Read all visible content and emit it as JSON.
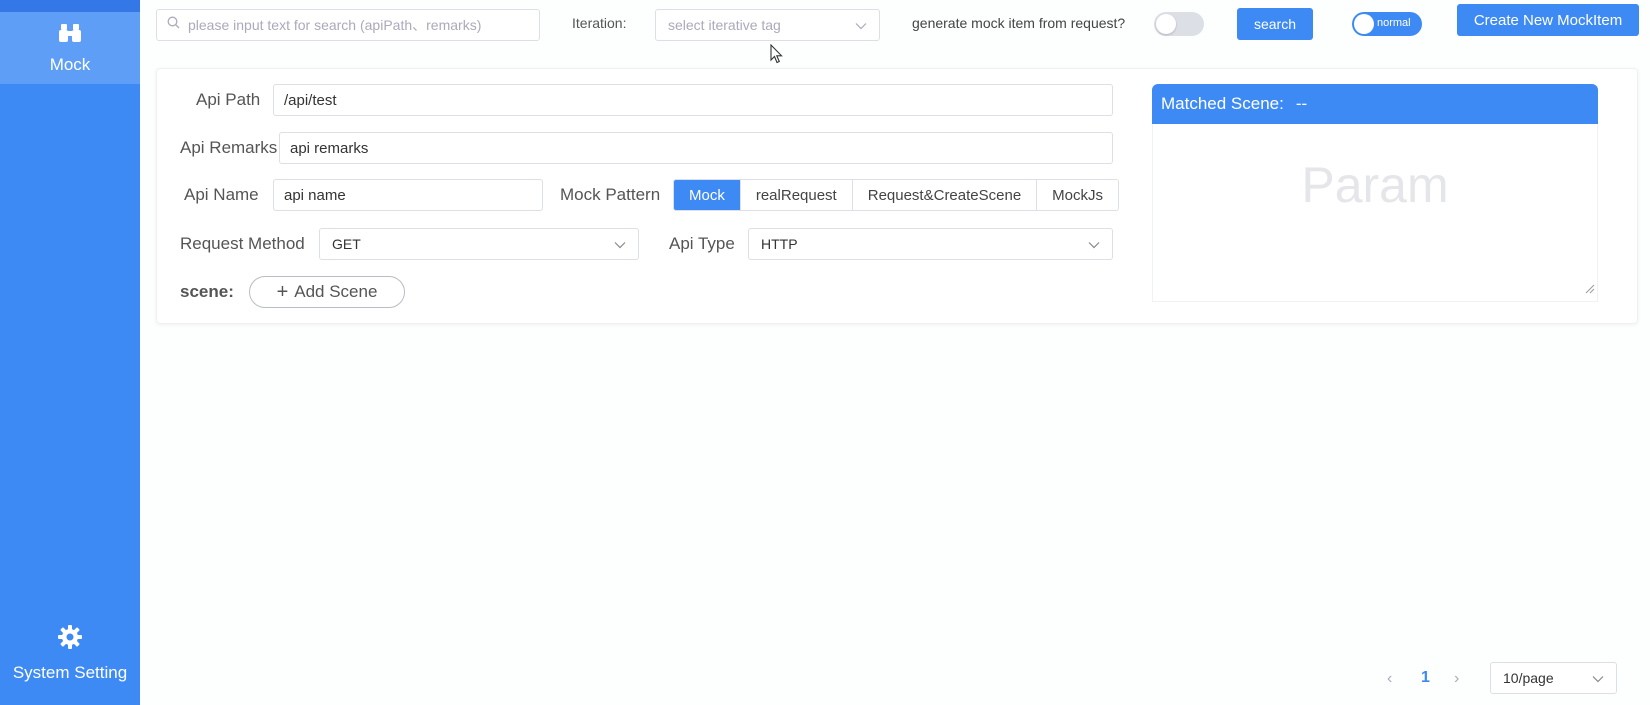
{
  "sidebar": {
    "items": [
      {
        "label": "Mock",
        "icon": "binoculars-icon"
      },
      {
        "label": "System Setting",
        "icon": "gear-icon"
      }
    ]
  },
  "toolbar": {
    "search_placeholder": "please input text for search (apiPath、remarks)",
    "iteration_label": "Iteration:",
    "iteration_placeholder": "select iterative tag",
    "generate_label": "generate mock item from request?",
    "search_button": "search",
    "mode_switch_label": "normal",
    "create_button": "Create New MockItem"
  },
  "form": {
    "api_path_label": "Api Path",
    "api_path_value": "/api/test",
    "api_remarks_label": "Api Remarks",
    "api_remarks_value": "api remarks",
    "api_name_label": "Api Name",
    "api_name_value": "api name",
    "mock_pattern_label": "Mock Pattern",
    "mock_pattern_options": [
      "Mock",
      "realRequest",
      "Request&CreateScene",
      "MockJs"
    ],
    "request_method_label": "Request Method",
    "request_method_value": "GET",
    "api_type_label": "Api Type",
    "api_type_value": "HTTP",
    "scene_label": "scene:",
    "add_scene_button": "Add Scene"
  },
  "matched_scene": {
    "title": "Matched Scene:",
    "value": "--",
    "param_placeholder": "Param"
  },
  "pagination": {
    "current_page": "1",
    "page_size": "10/page"
  },
  "colors": {
    "primary": "#3d8af5",
    "sidebar": "#3d8af5",
    "sidebar_active": "#5e9ef7"
  }
}
